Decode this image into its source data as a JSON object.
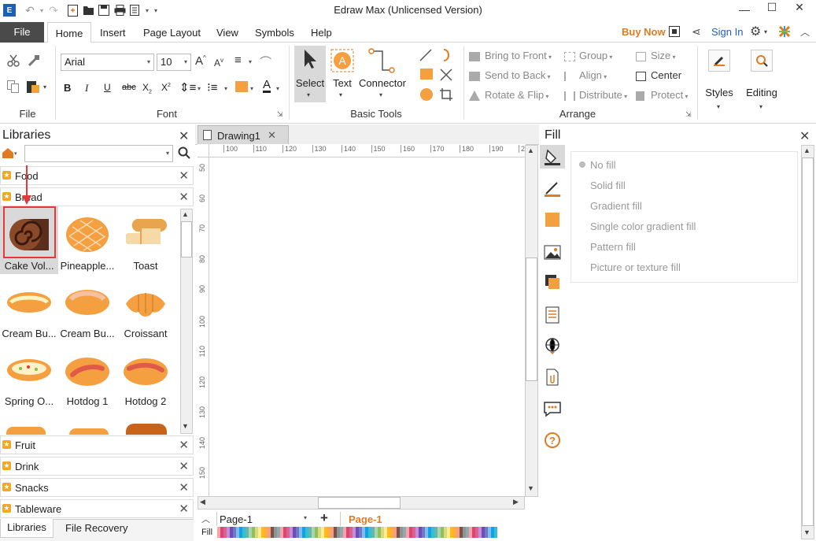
{
  "app": {
    "title": "Edraw Max (Unlicensed Version)",
    "window_controls": {
      "minimize": "—",
      "maximize": "☐",
      "close": "✕"
    }
  },
  "menu": {
    "file": "File",
    "tabs": [
      "Home",
      "Insert",
      "Page Layout",
      "View",
      "Symbols",
      "Help"
    ],
    "active_tab": "Home",
    "buy_now": "Buy Now",
    "sign_in": "Sign In"
  },
  "ribbon": {
    "file_group": "File",
    "font_group": "Font",
    "font_name": "Arial",
    "font_size": "10",
    "basic_tools_group": "Basic Tools",
    "select": "Select",
    "text": "Text",
    "connector": "Connector",
    "arrange_group": "Arrange",
    "bring_to_front": "Bring to Front",
    "send_to_back": "Send to Back",
    "rotate_flip": "Rotate & Flip",
    "group": "Group",
    "align": "Align",
    "distribute": "Distribute",
    "size": "Size",
    "center": "Center",
    "protect": "Protect",
    "styles": "Styles",
    "editing": "Editing"
  },
  "libraries": {
    "title": "Libraries",
    "search_placeholder": "",
    "categories_open": [
      "Food",
      "Bread"
    ],
    "shapes": [
      {
        "label": "Cake Vol...",
        "icon": "cake-roll-icon"
      },
      {
        "label": "Pineapple...",
        "icon": "pineapple-bun-icon"
      },
      {
        "label": "Toast",
        "icon": "toast-icon"
      },
      {
        "label": "Cream Bu...",
        "icon": "cream-bun-icon"
      },
      {
        "label": "Cream Bu...",
        "icon": "cream-bun-icon"
      },
      {
        "label": "Croissant",
        "icon": "croissant-icon"
      },
      {
        "label": "Spring O...",
        "icon": "spring-onion-bread-icon"
      },
      {
        "label": "Hotdog 1",
        "icon": "hotdog-icon"
      },
      {
        "label": "Hotdog 2",
        "icon": "hotdog-icon"
      }
    ],
    "categories_closed": [
      "Fruit",
      "Drink",
      "Snacks",
      "Tableware"
    ],
    "bottom_tabs": [
      "Libraries",
      "File Recovery"
    ]
  },
  "document": {
    "tab": "Drawing1",
    "ruler_h": [
      "100",
      "110",
      "120",
      "130",
      "140",
      "150",
      "160",
      "170",
      "180",
      "190",
      "2"
    ],
    "ruler_v": [
      "50",
      "60",
      "70",
      "80",
      "90",
      "100",
      "110",
      "120",
      "130",
      "140",
      "150"
    ],
    "page_selector": "Page-1",
    "active_page": "Page-1",
    "fill_label": "Fill"
  },
  "fill_panel": {
    "title": "Fill",
    "options": [
      "No fill",
      "Solid fill",
      "Gradient fill",
      "Single color gradient fill",
      "Pattern fill",
      "Picture or texture fill"
    ],
    "selected": "No fill"
  },
  "colors": {
    "accent": "#e07b22",
    "highlight_box": "#e53935",
    "file_tab_bg": "#4a4a4a",
    "sidebar_orange": "#f5a040"
  }
}
